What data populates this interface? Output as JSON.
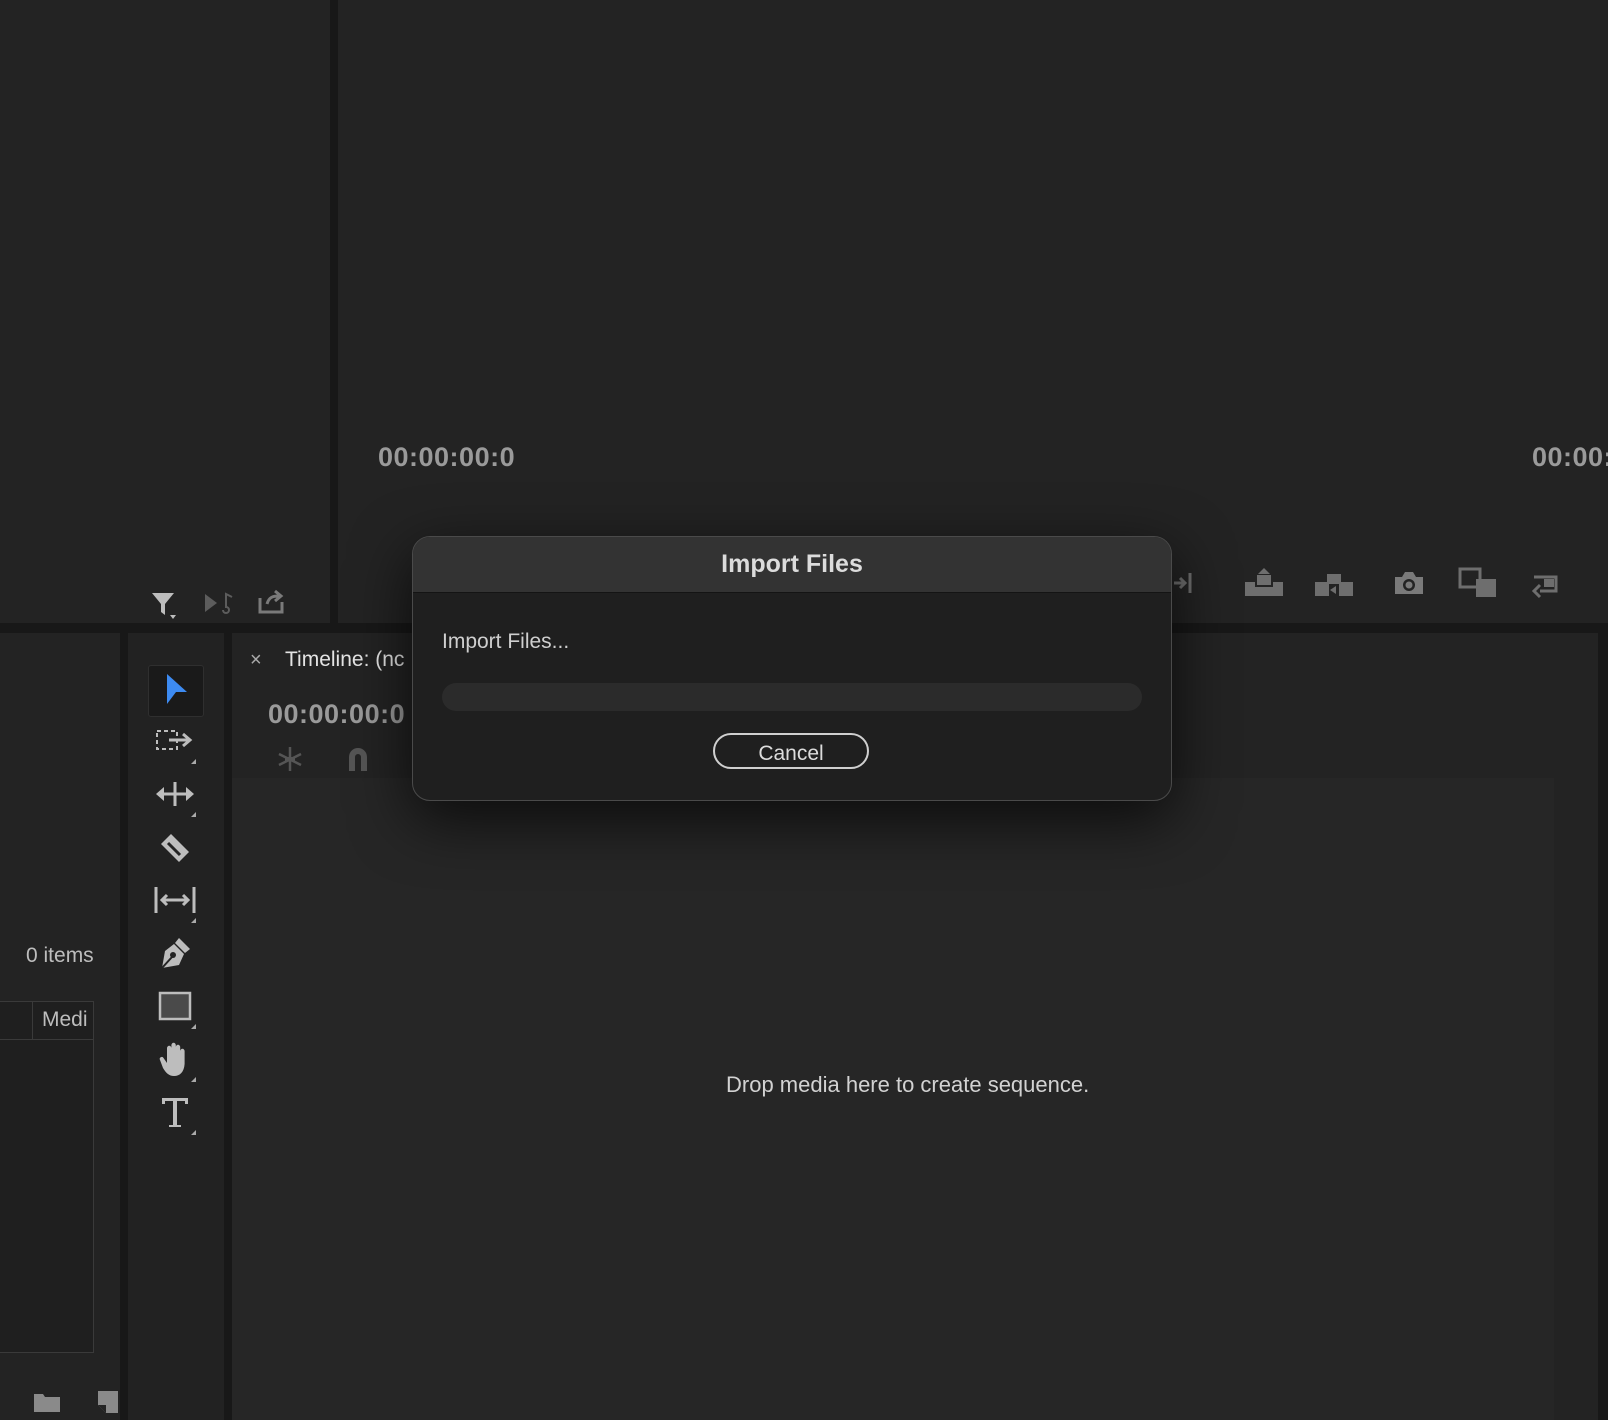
{
  "program_monitor": {
    "timecode_left": "00:00:00:0",
    "timecode_right": "00:00:"
  },
  "source_panel": {
    "icons": [
      "filter-icon",
      "audio-drag-icon",
      "export-icon"
    ]
  },
  "project_panel": {
    "items_count": "0 items",
    "column_header": "Medi"
  },
  "tools": [
    {
      "name": "selection-tool",
      "active": true
    },
    {
      "name": "track-select-tool"
    },
    {
      "name": "ripple-edit-tool"
    },
    {
      "name": "razor-tool"
    },
    {
      "name": "slip-tool"
    },
    {
      "name": "pen-tool"
    },
    {
      "name": "rectangle-tool"
    },
    {
      "name": "hand-tool"
    },
    {
      "name": "type-tool"
    }
  ],
  "timeline": {
    "close_glyph": "×",
    "title": "Timeline: (nc",
    "timecode": "00:00:00:0",
    "empty_message": "Drop media here to create sequence."
  },
  "dialog": {
    "title": "Import Files",
    "message": "Import Files...",
    "progress_fraction": 0,
    "cancel_label": "Cancel"
  },
  "colors": {
    "accent": "#3d8bf2",
    "panel_bg": "#232323",
    "divider": "#181818"
  }
}
